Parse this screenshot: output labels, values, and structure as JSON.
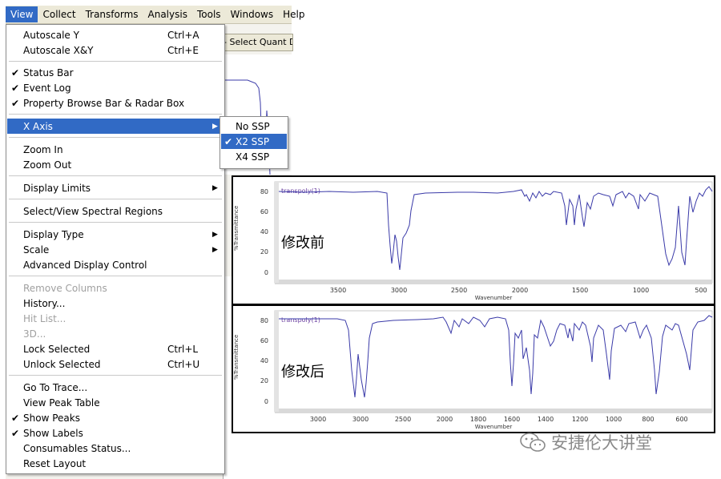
{
  "menubar": {
    "items": [
      "View",
      "Collect",
      "Transforms",
      "Analysis",
      "Tools",
      "Windows",
      "Help"
    ]
  },
  "toolbar": {
    "quant_select": "- Select Quant D"
  },
  "view_menu": {
    "autoscale_y": "Autoscale Y",
    "autoscale_y_sc": "Ctrl+A",
    "autoscale_xy": "Autoscale X&Y",
    "autoscale_xy_sc": "Ctrl+E",
    "status_bar": "Status Bar",
    "event_log": "Event Log",
    "property_bar": "Property Browse Bar & Radar Box",
    "x_axis": "X Axis",
    "zoom_in": "Zoom In",
    "zoom_out": "Zoom Out",
    "display_limits": "Display Limits",
    "select_regions": "Select/View Spectral Regions",
    "display_type": "Display Type",
    "scale": "Scale",
    "advanced": "Advanced Display Control",
    "remove_columns": "Remove Columns",
    "history": "History...",
    "hit_list": "Hit List...",
    "three_d": "3D...",
    "lock": "Lock Selected",
    "lock_sc": "Ctrl+L",
    "unlock": "Unlock Selected",
    "unlock_sc": "Ctrl+U",
    "go_to_trace": "Go To Trace...",
    "peak_table": "View Peak Table",
    "show_peaks": "Show Peaks",
    "show_labels": "Show Labels",
    "consumables": "Consumables Status...",
    "reset_layout": "Reset Layout"
  },
  "x_axis_submenu": {
    "no_ssp": "No SSP",
    "x2_ssp": "X2 SSP",
    "x4_ssp": "X4 SSP",
    "selected": "X2 SSP"
  },
  "spectrum_before": {
    "caption": "修改前",
    "trace_label": "transpoly(1)",
    "ylabel": "%Transmittance",
    "xlabel": "Wavenumber",
    "yticks": [
      "80",
      "60",
      "40",
      "20",
      "0"
    ],
    "xticks": [
      "3500",
      "3000",
      "2500",
      "2000",
      "1500",
      "1000",
      "500"
    ]
  },
  "spectrum_after": {
    "caption": "修改后",
    "trace_label": "transpoly(1)",
    "ylabel": "%Transmittance",
    "xlabel": "Wavenumber",
    "yticks": [
      "80",
      "60",
      "40",
      "20",
      "0"
    ],
    "xticks": [
      "3000",
      "3000",
      "2500",
      "2000",
      "1800",
      "1600",
      "1400",
      "1200",
      "1000",
      "800",
      "600"
    ]
  },
  "watermark": "安捷伦大讲堂",
  "colors": {
    "highlight": "#316ac5",
    "trace": "#3a3aa8",
    "menubar": "#ece9d8"
  }
}
